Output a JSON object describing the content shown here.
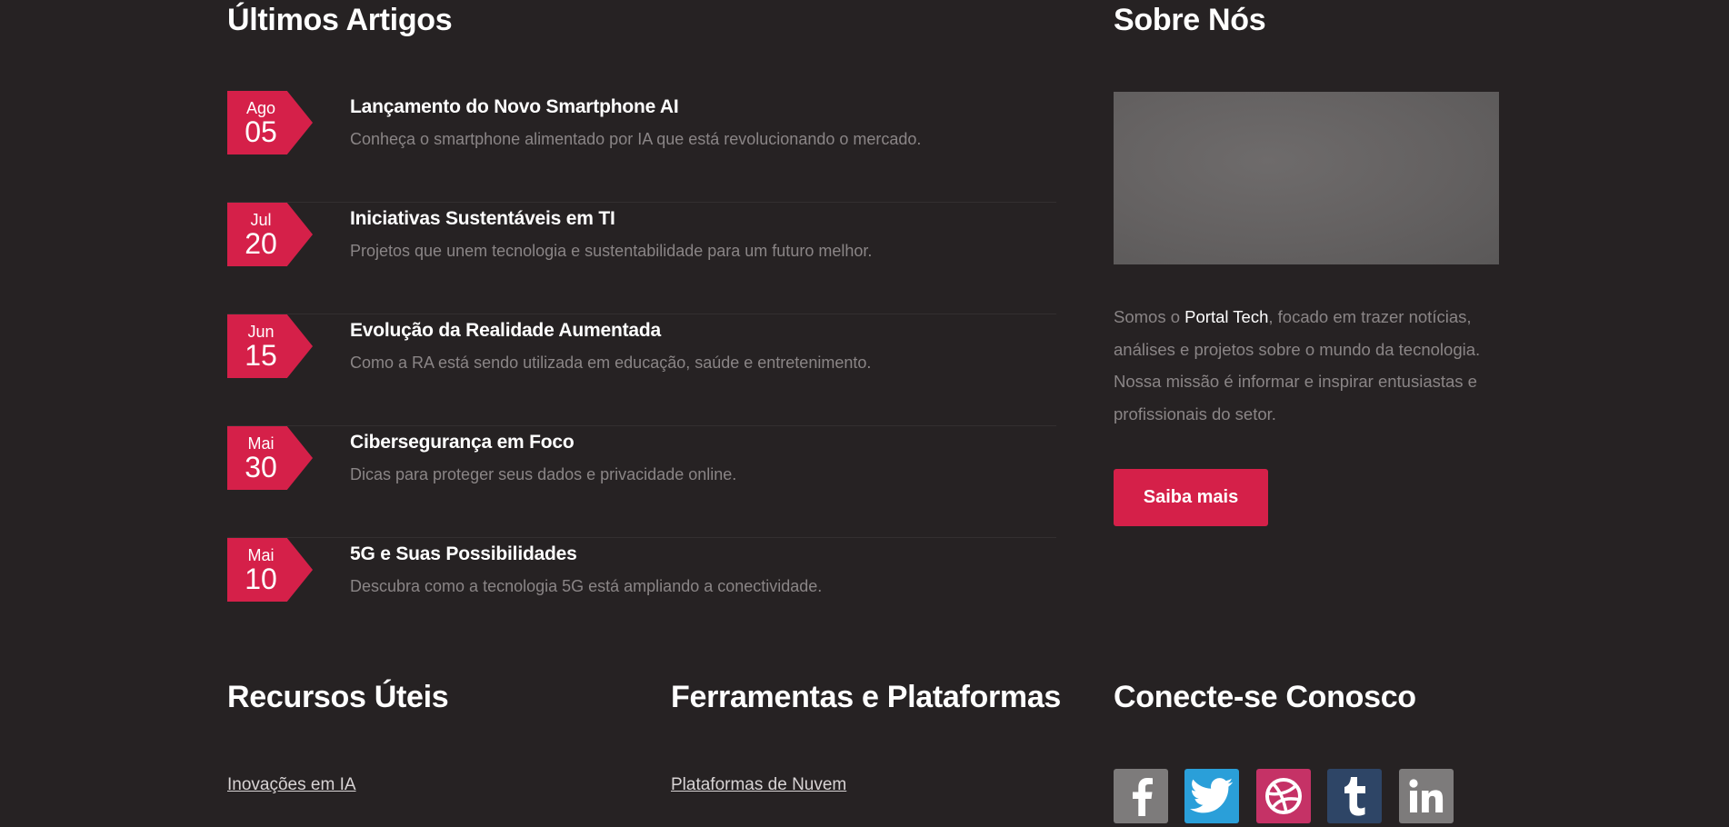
{
  "articles_section": {
    "title": "Últimos Artigos",
    "items": [
      {
        "month": "Ago",
        "day": "05",
        "title": "Lançamento do Novo Smartphone AI",
        "excerpt": "Conheça o smartphone alimentado por IA que está revolucionando o mercado."
      },
      {
        "month": "Jul",
        "day": "20",
        "title": "Iniciativas Sustentáveis em TI",
        "excerpt": "Projetos que unem tecnologia e sustentabilidade para um futuro melhor."
      },
      {
        "month": "Jun",
        "day": "15",
        "title": "Evolução da Realidade Aumentada",
        "excerpt": "Como a RA está sendo utilizada em educação, saúde e entretenimento."
      },
      {
        "month": "Mai",
        "day": "30",
        "title": "Cibersegurança em Foco",
        "excerpt": "Dicas para proteger seus dados e privacidade online."
      },
      {
        "month": "Mai",
        "day": "10",
        "title": "5G e Suas Possibilidades",
        "excerpt": "Descubra como a tecnologia 5G está ampliando a conectividade."
      }
    ]
  },
  "about_section": {
    "title": "Sobre Nós",
    "text_before": "Somos o ",
    "brand": "Portal Tech",
    "text_after": ", focado em trazer notícias, análises e projetos sobre o mundo da tecnologia. Nossa missão é informar e inspirar entusiastas e profissionais do setor.",
    "button_label": "Saiba mais"
  },
  "resources_section": {
    "title": "Recursos Úteis",
    "links": [
      "Inovações em IA"
    ]
  },
  "tools_section": {
    "title": "Ferramentas e Plataformas",
    "links": [
      "Plataformas de Nuvem"
    ]
  },
  "connect_section": {
    "title": "Conecte-se Conosco",
    "social": [
      {
        "icon": "facebook-icon",
        "color": "#7d7b7b"
      },
      {
        "icon": "twitter-icon",
        "color": "#2a9fd9"
      },
      {
        "icon": "dribbble-icon",
        "color": "#c53266"
      },
      {
        "icon": "tumblr-icon",
        "color": "#2e4566"
      },
      {
        "icon": "linkedin-icon",
        "color": "#7d7b7b"
      }
    ]
  },
  "colors": {
    "background": "#262223",
    "accent": "#d52049",
    "muted_text": "#8a8586"
  }
}
